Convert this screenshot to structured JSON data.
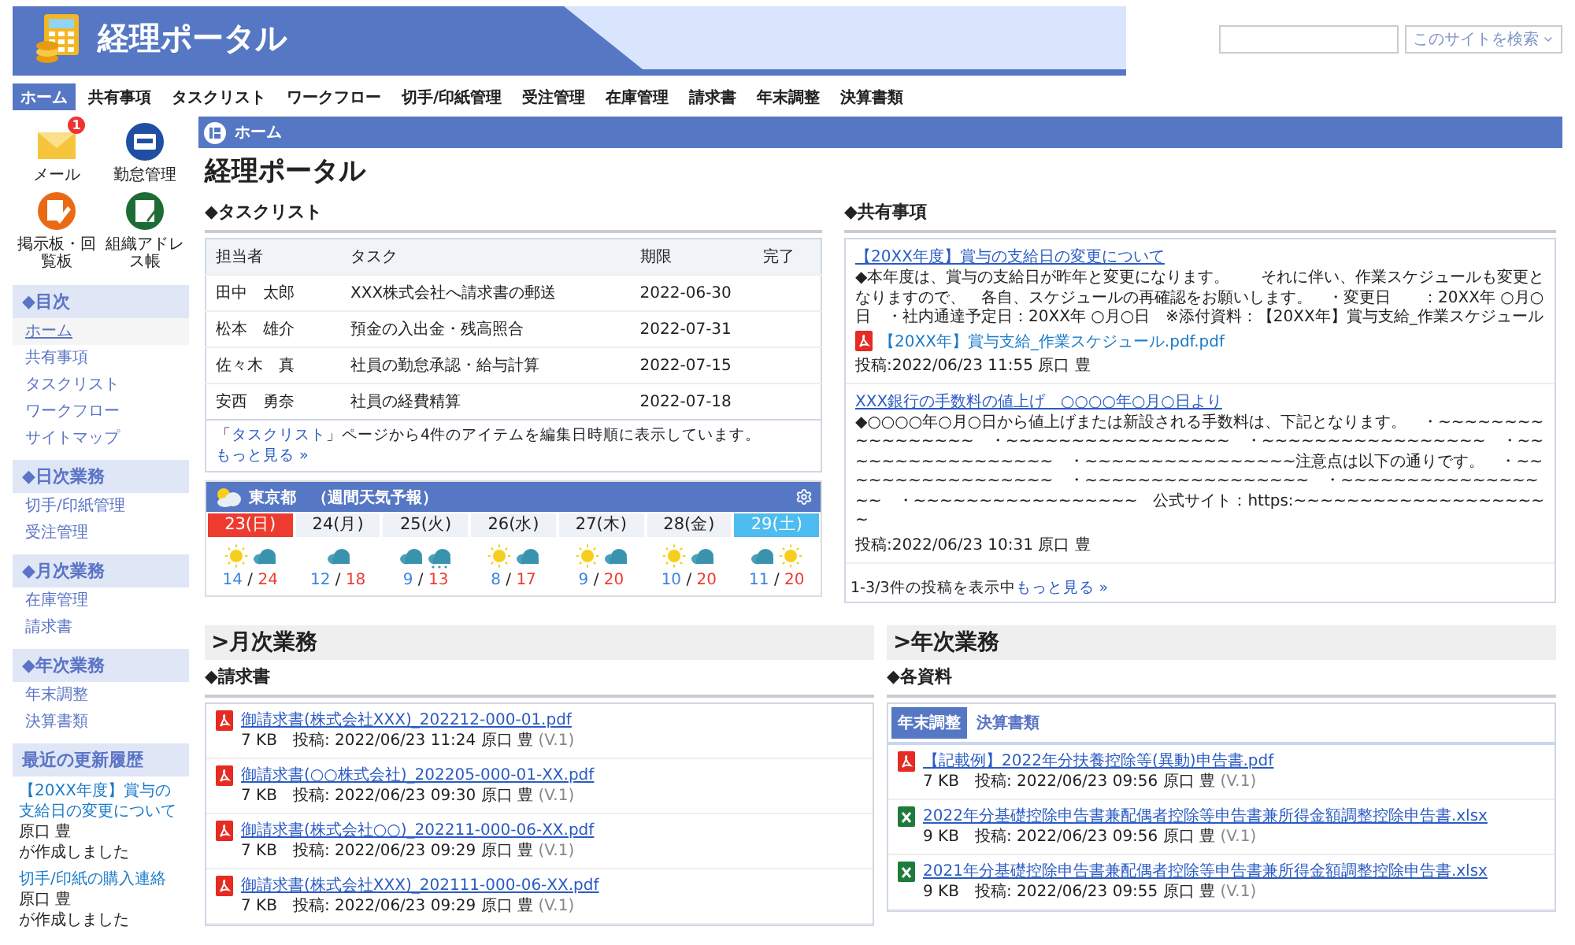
{
  "header": {
    "title": "経理ポータル",
    "search_button": "このサイトを検索"
  },
  "nav": [
    {
      "label": "ホーム",
      "selected": true
    },
    {
      "label": "共有事項",
      "selected": false
    },
    {
      "label": "タスクリスト",
      "selected": false
    },
    {
      "label": "ワークフロー",
      "selected": false
    },
    {
      "label": "切手/印紙管理",
      "selected": false
    },
    {
      "label": "受注管理",
      "selected": false
    },
    {
      "label": "在庫管理",
      "selected": false
    },
    {
      "label": "請求書",
      "selected": false
    },
    {
      "label": "年末調整",
      "selected": false
    },
    {
      "label": "決算書類",
      "selected": false
    }
  ],
  "quick_links": [
    {
      "label": "メール",
      "kind": "mail",
      "badge": "1"
    },
    {
      "label": "勤怠管理",
      "kind": "attendance"
    },
    {
      "label": "掲示板・回覧板",
      "kind": "board"
    },
    {
      "label": "組織アドレス帳",
      "kind": "address"
    }
  ],
  "sidebar": {
    "sections": [
      {
        "heading": "◆目次",
        "items": [
          {
            "label": "ホーム",
            "selected": true
          },
          {
            "label": "共有事項",
            "selected": false
          },
          {
            "label": "タスクリスト",
            "selected": false
          },
          {
            "label": "ワークフロー",
            "selected": false
          },
          {
            "label": "サイトマップ",
            "selected": false
          }
        ]
      },
      {
        "heading": "◆日次業務",
        "items": [
          {
            "label": "切手/印紙管理",
            "selected": false
          },
          {
            "label": "受注管理",
            "selected": false
          }
        ]
      },
      {
        "heading": "◆月次業務",
        "items": [
          {
            "label": "在庫管理",
            "selected": false
          },
          {
            "label": "請求書",
            "selected": false
          }
        ]
      },
      {
        "heading": "◆年次業務",
        "items": [
          {
            "label": "年末調整",
            "selected": false
          },
          {
            "label": "決算書類",
            "selected": false
          }
        ]
      }
    ],
    "recent": {
      "heading": "最近の更新履歴",
      "entries": [
        {
          "title": "【20XX年度】賞与の支給日の変更について",
          "author": "原口 豊",
          "action": "が作成しました"
        },
        {
          "title": "切手/印紙の購入連絡",
          "author": "原口 豊",
          "action": "が作成しました"
        }
      ]
    }
  },
  "page_bar": "ホーム",
  "page_title": "経理ポータル",
  "tasklist": {
    "heading": "◆タスクリスト",
    "columns": [
      "担当者",
      "タスク",
      "期限",
      "完了"
    ],
    "rows": [
      {
        "owner": "田中　太郎",
        "task": "XXX株式会社へ請求書の郵送",
        "due": "2022-06-30"
      },
      {
        "owner": "松本　雄介",
        "task": "預金の入出金・残高照合",
        "due": "2022-07-31"
      },
      {
        "owner": "佐々木　真",
        "task": "社員の勤怠承認・給与計算",
        "due": "2022-07-15"
      },
      {
        "owner": "安西　勇奈",
        "task": "社員の経費精算",
        "due": "2022-07-18"
      }
    ],
    "footer": {
      "before": "「",
      "link": "タスクリスト",
      "after": "」ページから4件のアイテムを編集日時順に表示しています。",
      "more": "もっと見る »"
    }
  },
  "weather": {
    "title": "東京都　（週間天気予報）",
    "days": [
      {
        "date": "23(日)",
        "kind": "sunday",
        "icons": [
          {
            "kind": "sun"
          },
          {
            "kind": "cloud"
          }
        ],
        "low": "14",
        "sep": "/",
        "high": "24"
      },
      {
        "date": "24(月)",
        "kind": "weekday",
        "icons": [
          {
            "kind": "cloud"
          }
        ],
        "low": "12",
        "sep": "/",
        "high": "18"
      },
      {
        "date": "25(火)",
        "kind": "weekday",
        "icons": [
          {
            "kind": "cloud"
          },
          {
            "kind": "rain"
          }
        ],
        "low": "9",
        "sep": "/",
        "high": "13"
      },
      {
        "date": "26(水)",
        "kind": "weekday",
        "icons": [
          {
            "kind": "sun"
          },
          {
            "kind": "cloud"
          }
        ],
        "low": "8",
        "sep": "/",
        "high": "17"
      },
      {
        "date": "27(木)",
        "kind": "weekday",
        "icons": [
          {
            "kind": "sun"
          },
          {
            "kind": "cloud"
          }
        ],
        "low": "9",
        "sep": "/",
        "high": "20"
      },
      {
        "date": "28(金)",
        "kind": "weekday",
        "icons": [
          {
            "kind": "sun"
          },
          {
            "kind": "cloud"
          }
        ],
        "low": "10",
        "sep": "/",
        "high": "20"
      },
      {
        "date": "29(土)",
        "kind": "saturday",
        "icons": [
          {
            "kind": "cloud"
          },
          {
            "kind": "sun"
          }
        ],
        "low": "11",
        "sep": "/",
        "high": "20"
      }
    ]
  },
  "shared": {
    "heading": "◆共有事項",
    "posts": [
      {
        "title": "【20XX年度】賞与の支給日の変更について",
        "body": "◆本年度は、賞与の支給日が昨年と変更になります。　　それに伴い、作業スケジュールも変更となりますので、　各自、スケジュールの再確認をお願いします。　・変更日　　：20XX年 ○月○日　・社内通達予定日：20XX年 ○月○日　※添付資料：【20XX年】賞与支給_作業スケジュール",
        "attachment": "【20XX年】賞与支給_作業スケジュール.pdf.pdf",
        "meta": "投稿:2022/06/23 11:55 原口 豊"
      },
      {
        "title": "XXX銀行の手数料の値上げ　○○○○年○月○日より",
        "body": "◆○○○○年○月○日から値上げまたは新設される手数料は、下記となります。　・~~~~~~~~~~~~~~~~~　・~~~~~~~~~~~~~~~~~　・~~~~~~~~~~~~~~~~~　・~~~~~~~~~~~~~~~~~　・~~~~~~~~~~~~~~~~注意点は以下の通りです。　・~~~~~~~~~~~~~~~~~　・~~~~~~~~~~~~~~~~~　・~~~~~~~~~~~~~~~~~　・~~~~~~~~~~~~~~~~~　公式サイト：https:~~~~~~~~~~~~~~~~~~~~",
        "meta": "投稿:2022/06/23 10:31 原口 豊"
      }
    ],
    "count": "1-3/3件の投稿を表示中",
    "more": "もっと見る »"
  },
  "monthly": {
    "heading": ">月次業務",
    "section": "◆請求書",
    "files": [
      {
        "name": "御請求書(株式会社XXX)_202212-000-01.pdf",
        "kind": "pdf",
        "size": "7 KB",
        "posted": "投稿: 2022/06/23 11:24 原口 豊",
        "version": "(V.1)"
      },
      {
        "name": "御請求書(○○株式会社)_202205-000-01-XX.pdf",
        "kind": "pdf",
        "size": "7 KB",
        "posted": "投稿: 2022/06/23 09:30 原口 豊",
        "version": "(V.1)"
      },
      {
        "name": "御請求書(株式会社○○)_202211-000-06-XX.pdf",
        "kind": "pdf",
        "size": "7 KB",
        "posted": "投稿: 2022/06/23 09:29 原口 豊",
        "version": "(V.1)"
      },
      {
        "name": "御請求書(株式会社XXX)_202111-000-06-XX.pdf",
        "kind": "pdf",
        "size": "7 KB",
        "posted": "投稿: 2022/06/23 09:29 原口 豊",
        "version": "(V.1)"
      }
    ]
  },
  "annual": {
    "heading": ">年次業務",
    "section": "◆各資料",
    "tabs": [
      {
        "label": "年末調整",
        "selected": true
      },
      {
        "label": "決算書類",
        "selected": false
      }
    ],
    "files": [
      {
        "name": "【記載例】2022年分扶養控除等(異動)申告書.pdf",
        "kind": "pdf",
        "size": "7 KB",
        "posted": "投稿: 2022/06/23 09:56 原口 豊",
        "version": "(V.1)"
      },
      {
        "name": "2022年分基礎控除申告書兼配偶者控除等申告書兼所得金額調整控除申告書.xlsx",
        "kind": "xlsx",
        "size": "9 KB",
        "posted": "投稿: 2022/06/23 09:56 原口 豊",
        "version": "(V.1)"
      },
      {
        "name": "2021年分基礎控除申告書兼配偶者控除等申告書兼所得金額調整控除申告書.xlsx",
        "kind": "xlsx",
        "size": "9 KB",
        "posted": "投稿: 2022/06/23 09:55 原口 豊",
        "version": "(V.1)"
      }
    ]
  }
}
